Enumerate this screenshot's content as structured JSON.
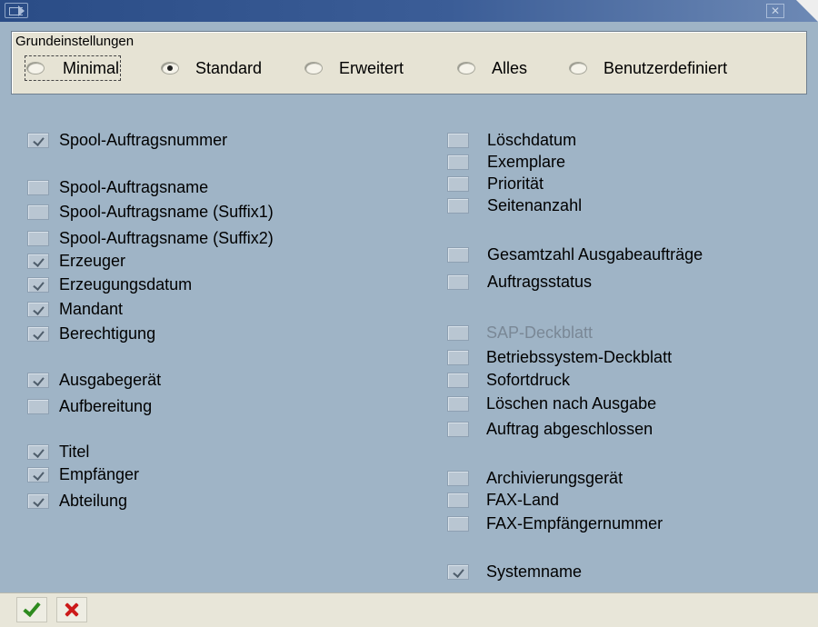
{
  "group": {
    "title": "Grundeinstellungen",
    "options": [
      {
        "label": "Minimal",
        "selected": false
      },
      {
        "label": "Standard",
        "selected": true
      },
      {
        "label": "Erweitert",
        "selected": false
      },
      {
        "label": "Alles",
        "selected": false
      },
      {
        "label": "Benutzerdefiniert",
        "selected": false
      }
    ]
  },
  "left": [
    {
      "label": "Spool-Auftragsnummer",
      "checked": true
    },
    {
      "label": "Spool-Auftragsname",
      "checked": false
    },
    {
      "label": "Spool-Auftragsname (Suffix1)",
      "checked": false
    },
    {
      "label": "Spool-Auftragsname (Suffix2)",
      "checked": false
    },
    {
      "label": "Erzeuger",
      "checked": true
    },
    {
      "label": "Erzeugungsdatum",
      "checked": true
    },
    {
      "label": "Mandant",
      "checked": true
    },
    {
      "label": "Berechtigung",
      "checked": true
    },
    {
      "label": "Ausgabegerät",
      "checked": true
    },
    {
      "label": "Aufbereitung",
      "checked": false
    },
    {
      "label": "Titel",
      "checked": true
    },
    {
      "label": "Empfänger",
      "checked": true
    },
    {
      "label": "Abteilung",
      "checked": true
    }
  ],
  "right": [
    {
      "label": "Löschdatum",
      "checked": false
    },
    {
      "label": "Exemplare",
      "checked": false
    },
    {
      "label": "Priorität",
      "checked": false
    },
    {
      "label": "Seitenanzahl",
      "checked": false
    },
    {
      "label": "Gesamtzahl Ausgabeaufträge",
      "checked": false
    },
    {
      "label": "Auftragsstatus",
      "checked": false
    },
    {
      "label": "SAP-Deckblatt",
      "checked": false,
      "disabled": true
    },
    {
      "label": "Betriebssystem-Deckblatt",
      "checked": false
    },
    {
      "label": "Sofortdruck",
      "checked": false
    },
    {
      "label": "Löschen nach Ausgabe",
      "checked": false
    },
    {
      "label": "Auftrag abgeschlossen",
      "checked": false
    },
    {
      "label": "Archivierungsgerät",
      "checked": false
    },
    {
      "label": "FAX-Land",
      "checked": false
    },
    {
      "label": "FAX-Empfängernummer",
      "checked": false
    },
    {
      "label": "Systemname",
      "checked": true
    }
  ],
  "toolbar": {
    "confirm_icon": "check-icon",
    "cancel_icon": "cancel-x-icon"
  },
  "colors": {
    "background": "#9fb4c6",
    "groupbox": "#e6e3d4",
    "confirm": "#2e8b1f",
    "cancel": "#cc1a1a"
  }
}
